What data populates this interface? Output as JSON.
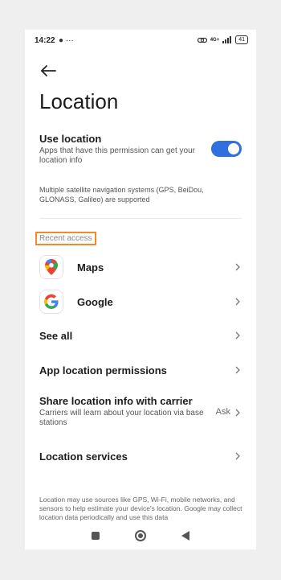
{
  "status": {
    "time": "14:22",
    "left_icons": "● ···",
    "network": "4G+",
    "battery": "41"
  },
  "page": {
    "title": "Location"
  },
  "use_location": {
    "title": "Use location",
    "subtitle": "Apps that have this permission can get your location info",
    "enabled": true
  },
  "note": "Multiple satellite navigation systems (GPS, BeiDou, GLONASS, Galileo) are supported",
  "recent_access": {
    "label": "Recent access",
    "apps": [
      {
        "name": "Maps",
        "icon": "google-maps-icon"
      },
      {
        "name": "Google",
        "icon": "google-icon"
      }
    ]
  },
  "see_all": "See all",
  "app_permissions": "App location permissions",
  "share_carrier": {
    "title": "Share location info with carrier",
    "subtitle": "Carriers will learn about your location via base stations",
    "value": "Ask"
  },
  "location_services": "Location services",
  "footer": "Location may use sources like GPS, Wi-Fi, mobile networks, and sensors to help estimate your device's location. Google may collect location data periodically and use this data"
}
